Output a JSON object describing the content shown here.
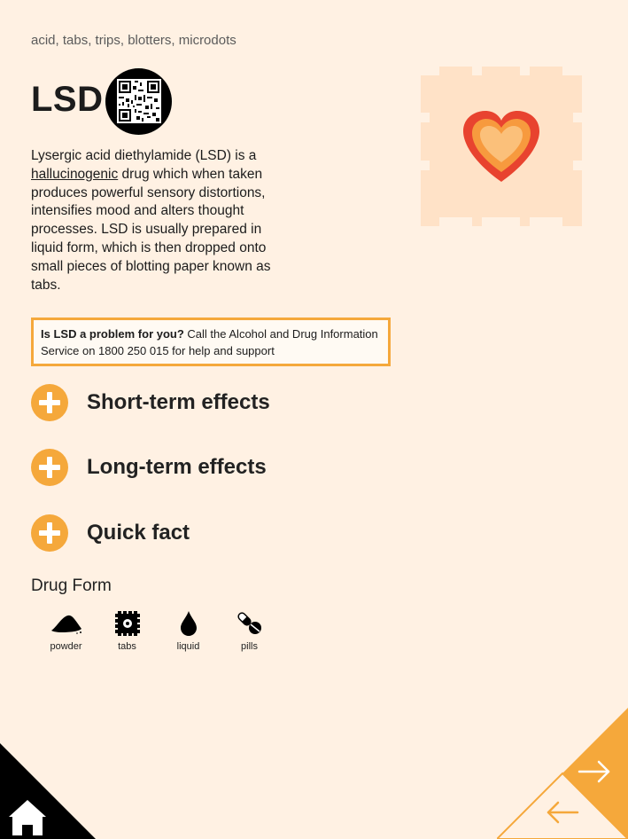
{
  "page": {
    "aliases": "acid, tabs, trips, blotters, microdots",
    "title": "LSD",
    "description": {
      "before": "Lysergic acid diethylamide (LSD) is a ",
      "term": "hallucinogenic",
      "after": " drug which when taken produces powerful sensory distortions, intensifies mood and alters thought processes. LSD is usually prepared in liquid form, which is then dropped onto small pieces of blotting paper known as tabs."
    },
    "help": {
      "bold": "Is LSD a problem for you?",
      "text": " Call the Alcohol and Drug Information Service on 1800 250 015 for help and support"
    }
  },
  "sections": [
    {
      "label": "Short-term effects"
    },
    {
      "label": "Long-term effects"
    },
    {
      "label": "Quick fact"
    }
  ],
  "drug_form": {
    "heading": "Drug Form",
    "items": [
      {
        "label": "powder",
        "icon": "powder-icon"
      },
      {
        "label": "tabs",
        "icon": "tab-icon"
      },
      {
        "label": "liquid",
        "icon": "droplet-icon"
      },
      {
        "label": "pills",
        "icon": "pills-icon"
      }
    ]
  },
  "colors": {
    "background": "#fff1e3",
    "accent": "#f5a83b",
    "heart_outer": "#e8432f",
    "heart_mid": "#f79a3e",
    "heart_inner": "#fbc07a",
    "stamp": "#ffe2c7"
  },
  "icons": {
    "home": "home-icon",
    "next": "arrow-right-icon",
    "back": "arrow-left-icon",
    "qr": "qr-code-icon"
  }
}
